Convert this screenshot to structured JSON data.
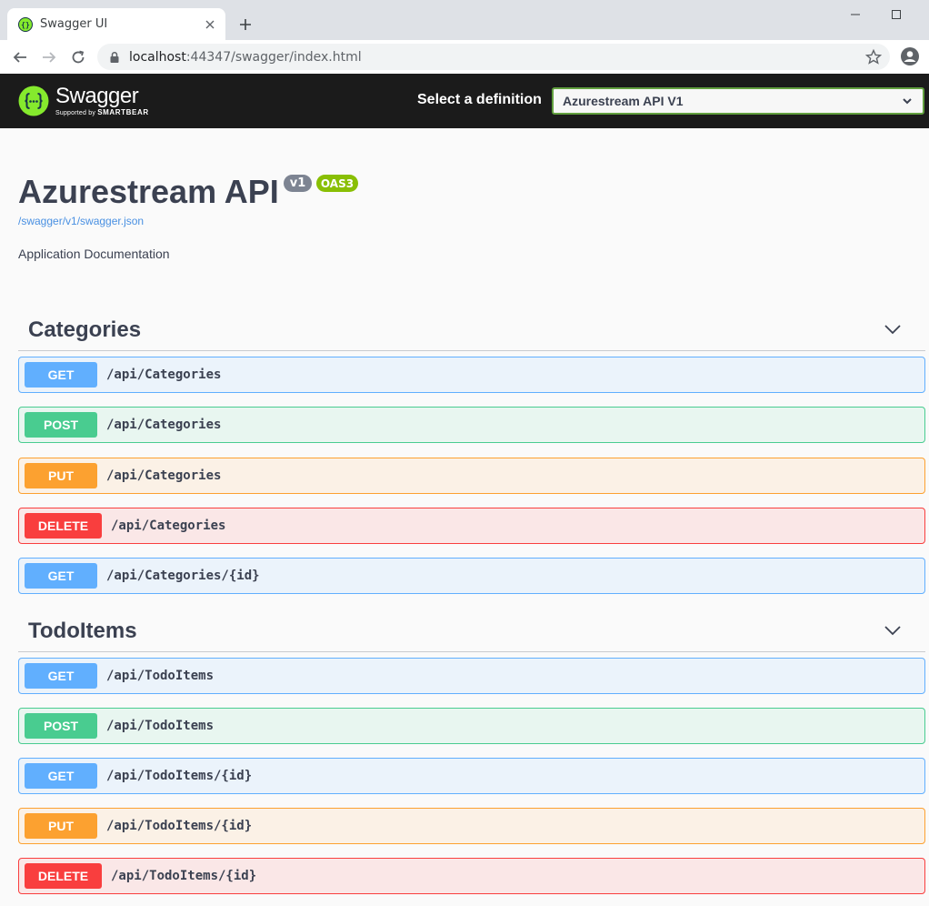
{
  "browser": {
    "tab_title": "Swagger UI",
    "url_host": "localhost",
    "url_path": ":44347/swagger/index.html"
  },
  "topbar": {
    "logo_name": "Swagger",
    "logo_supported_by": "Supported by",
    "logo_company": "SMARTBEAR",
    "select_label": "Select a definition",
    "selected_definition": "Azurestream API V1"
  },
  "info": {
    "title": "Azurestream API",
    "version": "v1",
    "oas": "OAS3",
    "spec_link": "/swagger/v1/swagger.json",
    "description": "Application Documentation"
  },
  "colors": {
    "get": "#61affe",
    "post": "#49cc90",
    "put": "#fca130",
    "delete": "#f93e3e",
    "topbar": "#1b1b1b"
  },
  "sections": [
    {
      "name": "Categories",
      "operations": [
        {
          "method": "GET",
          "path": "/api/Categories"
        },
        {
          "method": "POST",
          "path": "/api/Categories"
        },
        {
          "method": "PUT",
          "path": "/api/Categories"
        },
        {
          "method": "DELETE",
          "path": "/api/Categories"
        },
        {
          "method": "GET",
          "path": "/api/Categories/{id}"
        }
      ]
    },
    {
      "name": "TodoItems",
      "operations": [
        {
          "method": "GET",
          "path": "/api/TodoItems"
        },
        {
          "method": "POST",
          "path": "/api/TodoItems"
        },
        {
          "method": "GET",
          "path": "/api/TodoItems/{id}"
        },
        {
          "method": "PUT",
          "path": "/api/TodoItems/{id}"
        },
        {
          "method": "DELETE",
          "path": "/api/TodoItems/{id}"
        }
      ]
    }
  ]
}
